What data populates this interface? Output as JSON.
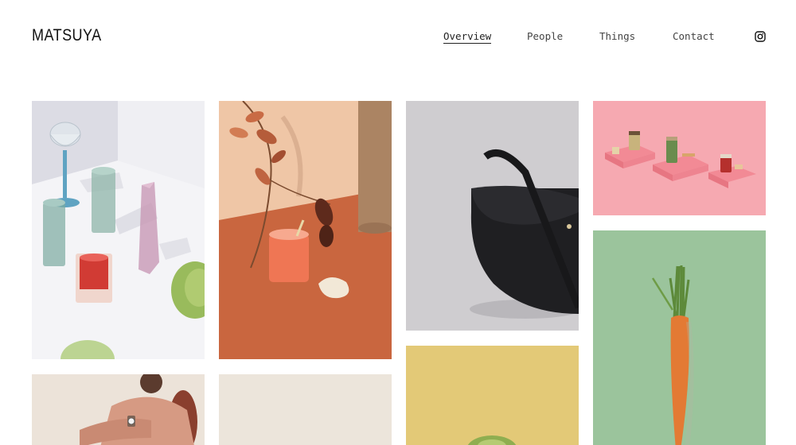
{
  "header": {
    "logo": "MATSUYA",
    "nav": [
      {
        "label": "Overview",
        "active": true
      },
      {
        "label": "People",
        "active": false
      },
      {
        "label": "Things",
        "active": false
      },
      {
        "label": "Contact",
        "active": false
      }
    ],
    "social_icon": "instagram-icon"
  },
  "gallery": {
    "images": [
      {
        "subject": "glassware",
        "background": "#e6e6ec"
      },
      {
        "subject": "dried-branch-smoothie",
        "background": "#c96840"
      },
      {
        "subject": "black-leather-bag",
        "background": "#cfcdcf"
      },
      {
        "subject": "jars-on-pink-blocks",
        "background": "#f6a9b0"
      },
      {
        "subject": "carrot",
        "background": "#9bc49c"
      },
      {
        "subject": "woman-pink-sweater",
        "background": "#e8ded4"
      },
      {
        "subject": "beige-blank",
        "background": "#ebe5dc"
      },
      {
        "subject": "cabbage-on-yellow",
        "background": "#e3c977"
      }
    ]
  },
  "colors": {
    "text": "#2a2a2a",
    "background": "#ffffff"
  }
}
